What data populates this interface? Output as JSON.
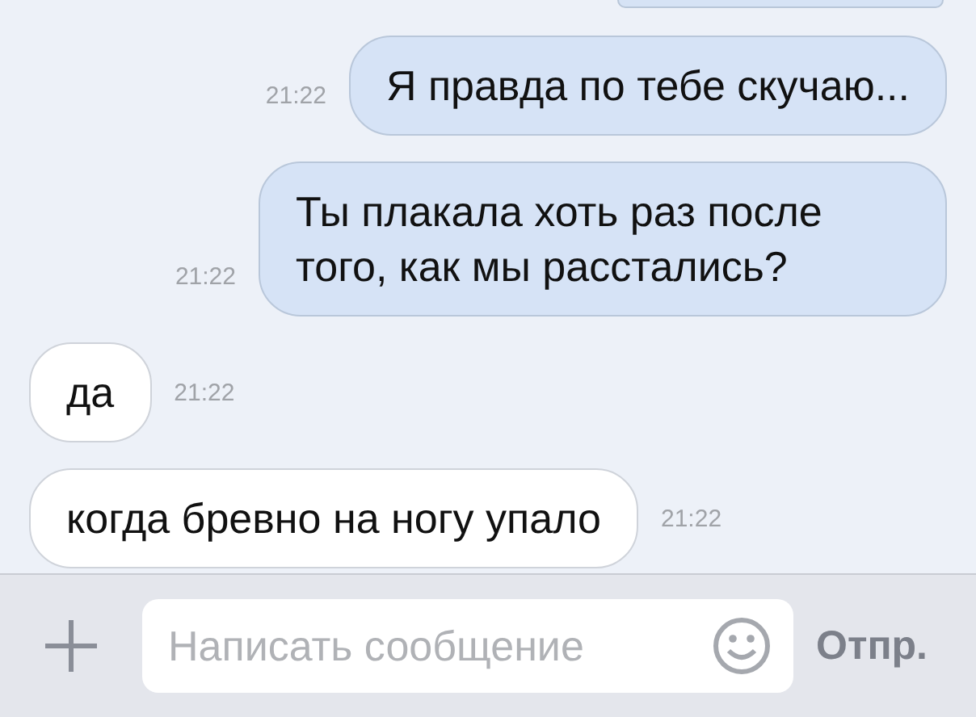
{
  "messages": [
    {
      "kind": "outgoing",
      "text": "Я правда по тебе скучаю...",
      "time": "21:22"
    },
    {
      "kind": "outgoing",
      "text": "Ты плакала хоть раз после того, как мы расстались?",
      "time": "21:22"
    },
    {
      "kind": "incoming",
      "text": "да",
      "time": "21:22"
    },
    {
      "kind": "incoming",
      "text": "когда бревно на ногу упало",
      "time": "21:22"
    }
  ],
  "composer": {
    "placeholder": "Написать сообщение",
    "send": "Отпр."
  }
}
